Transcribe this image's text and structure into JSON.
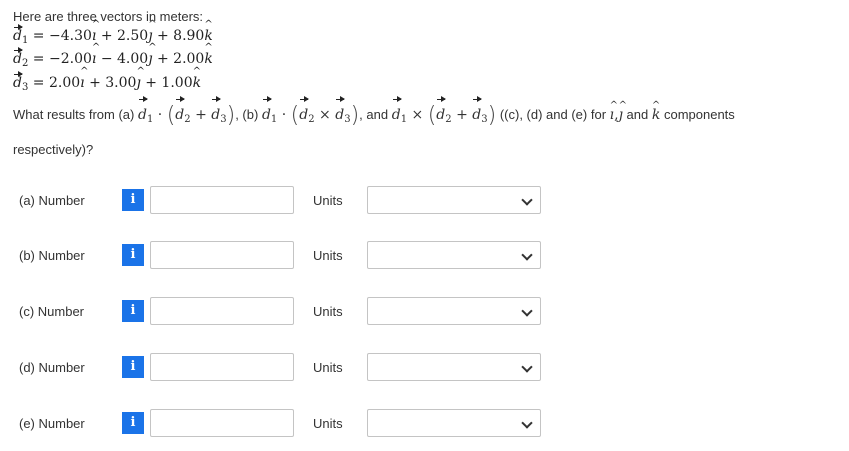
{
  "intro": "Here are three vectors in meters:",
  "vectors": [
    {
      "sub": "1",
      "text": "= −4.30",
      "j": "+ 2.50",
      "k": "+ 8.90"
    },
    {
      "sub": "2",
      "text": "= −2.00",
      "j": "− 4.00",
      "k": "+ 2.00"
    },
    {
      "sub": "3",
      "text": "= 2.00",
      "j": "+ 3.00",
      "k": "+ 1.00"
    }
  ],
  "question": {
    "prefix": "What results from (a)",
    "b": ", (b)",
    "and": ", and",
    "suffix": "((c), (d) and (e) for",
    "end": "components",
    "last_line": "respectively)?"
  },
  "rows": [
    {
      "label": "(a)  Number",
      "info": "i",
      "value": "",
      "units_label": "Units",
      "units_value": ""
    },
    {
      "label": "(b)  Number",
      "info": "i",
      "value": "",
      "units_label": "Units",
      "units_value": ""
    },
    {
      "label": "(c)  Number",
      "info": "i",
      "value": "",
      "units_label": "Units",
      "units_value": ""
    },
    {
      "label": "(d)  Number",
      "info": "i",
      "value": "",
      "units_label": "Units",
      "units_value": ""
    },
    {
      "label": "(e)  Number",
      "info": "i",
      "value": "",
      "units_label": "Units",
      "units_value": ""
    }
  ],
  "colors": {
    "info_button": "#1a73e8",
    "border": "#c4c4c4"
  }
}
